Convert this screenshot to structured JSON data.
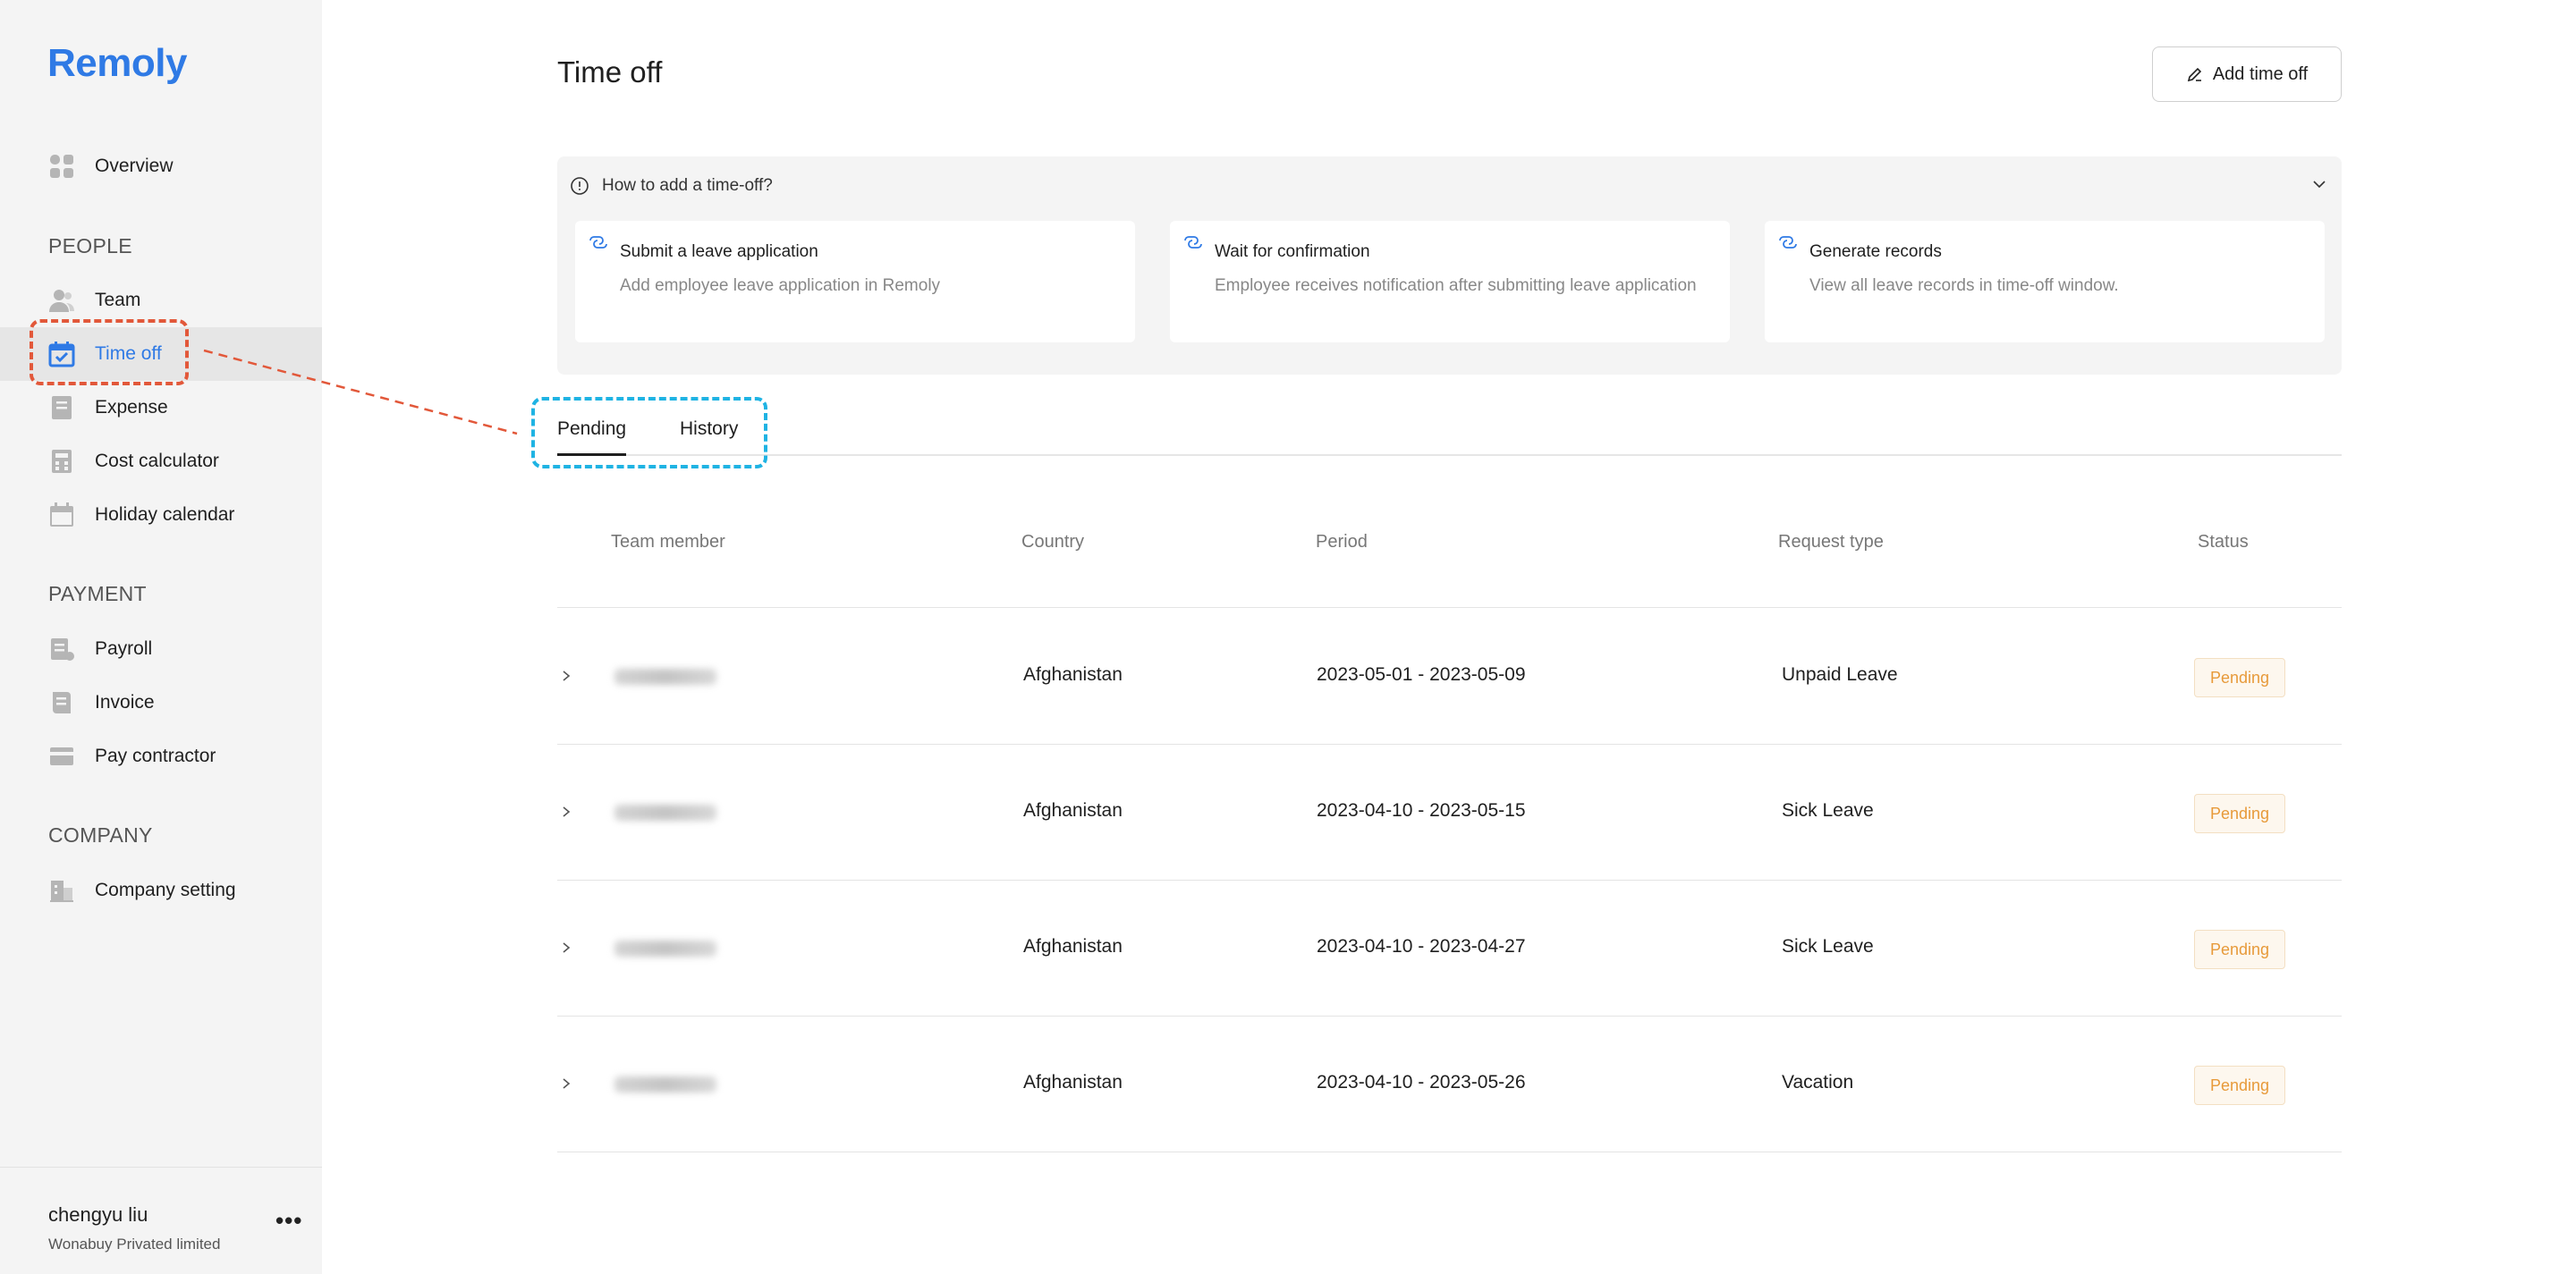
{
  "app": {
    "name": "Remoly"
  },
  "sidebar": {
    "items_top": [
      {
        "label": "Overview",
        "icon": "grid-icon"
      }
    ],
    "sections": [
      {
        "title": "PEOPLE",
        "items": [
          {
            "label": "Team",
            "icon": "users-icon"
          },
          {
            "label": "Time off",
            "icon": "calendar-check-icon",
            "active": true
          },
          {
            "label": "Expense",
            "icon": "receipt-icon"
          },
          {
            "label": "Cost calculator",
            "icon": "calculator-icon"
          },
          {
            "label": "Holiday calendar",
            "icon": "calendar-icon"
          }
        ]
      },
      {
        "title": "PAYMENT",
        "items": [
          {
            "label": "Payroll",
            "icon": "payroll-icon"
          },
          {
            "label": "Invoice",
            "icon": "invoice-icon"
          },
          {
            "label": "Pay contractor",
            "icon": "card-icon"
          }
        ]
      },
      {
        "title": "COMPANY",
        "items": [
          {
            "label": "Company setting",
            "icon": "building-icon"
          }
        ]
      }
    ],
    "user": {
      "name": "chengyu liu",
      "org": "Wonabuy Privated limited",
      "more": "•••"
    }
  },
  "main": {
    "title": "Time off",
    "add_button": "Add time off",
    "info": {
      "heading": "How to add a time-off?",
      "steps": [
        {
          "title": "Submit a leave application",
          "desc": "Add employee leave application in Remoly"
        },
        {
          "title": "Wait for confirmation",
          "desc": "Employee receives notification after submitting leave application"
        },
        {
          "title": "Generate records",
          "desc": "View all leave records in time-off window."
        }
      ]
    },
    "tabs": [
      {
        "label": "Pending",
        "active": true
      },
      {
        "label": "History"
      }
    ],
    "table": {
      "columns": [
        "Team member",
        "Country",
        "Period",
        "Request type",
        "Status"
      ],
      "rows": [
        {
          "country": "Afghanistan",
          "period": "2023-05-01 - 2023-05-09",
          "type": "Unpaid Leave",
          "status": "Pending"
        },
        {
          "country": "Afghanistan",
          "period": "2023-04-10 - 2023-05-15",
          "type": "Sick Leave",
          "status": "Pending"
        },
        {
          "country": "Afghanistan",
          "period": "2023-04-10 - 2023-04-27",
          "type": "Sick Leave",
          "status": "Pending"
        },
        {
          "country": "Afghanistan",
          "period": "2023-04-10 - 2023-05-26",
          "type": "Vacation",
          "status": "Pending"
        }
      ]
    }
  },
  "colors": {
    "accent": "#2f7ae5",
    "sidebar_bg": "#f4f4f4",
    "pending_text": "#e79a3a",
    "pending_bg": "#fdf7ee",
    "annotation_red": "#e2583a",
    "annotation_blue": "#1fb3e3"
  }
}
